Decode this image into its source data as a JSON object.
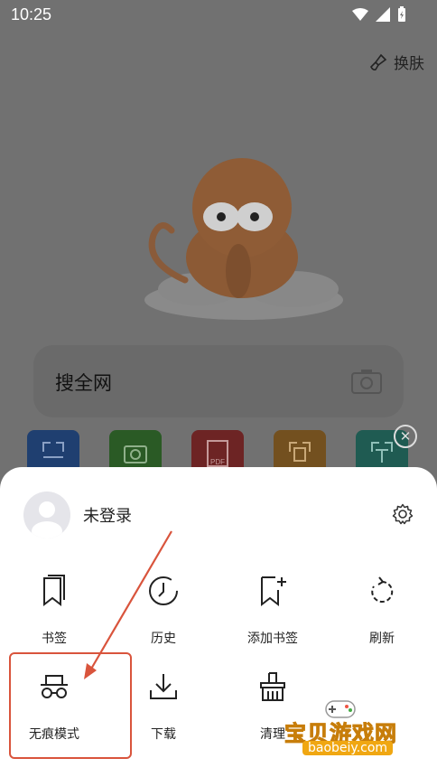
{
  "status": {
    "time": "10:25"
  },
  "header": {
    "skin_label": "换肤"
  },
  "search": {
    "label": "搜全网"
  },
  "profile": {
    "name": "未登录"
  },
  "menu": {
    "items": [
      {
        "label": "书签",
        "icon": "bookmark-icon"
      },
      {
        "label": "历史",
        "icon": "history-clock-icon"
      },
      {
        "label": "添加书签",
        "icon": "add-bookmark-icon"
      },
      {
        "label": "刷新",
        "icon": "refresh-icon"
      },
      {
        "label": "无痕模式",
        "icon": "incognito-icon"
      },
      {
        "label": "下载",
        "icon": "download-icon"
      },
      {
        "label": "清理",
        "icon": "broom-icon"
      }
    ]
  },
  "tools": [
    {
      "icon": "scan-icon",
      "color": "#1f56a8"
    },
    {
      "icon": "camera-icon",
      "color": "#2f8a2a"
    },
    {
      "icon": "pdf-icon",
      "color": "#b62a2a"
    },
    {
      "icon": "image-text-icon",
      "color": "#c87b15"
    },
    {
      "icon": "text-icon",
      "color": "#14877a"
    }
  ],
  "watermark": {
    "title": "宝贝游戏网",
    "subtitle": "baobeiy.com"
  },
  "colors": {
    "accent": "#d9543c"
  }
}
